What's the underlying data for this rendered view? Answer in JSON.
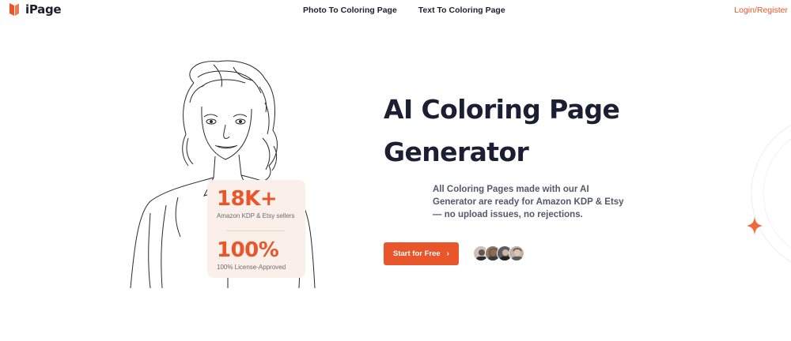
{
  "brand": {
    "name": "iPage",
    "color": "#e8562a"
  },
  "nav": {
    "links": [
      "Photo To Coloring Page",
      "Text To Coloring Page"
    ],
    "login": "Login/Register"
  },
  "hero": {
    "title_line1": "AI Coloring Page",
    "title_line2": "Generator",
    "description": "All Coloring Pages made with our AI Generator are ready for Amazon KDP & Etsy — no upload issues, no rejections.",
    "cta_label": "Start for Free",
    "cta_icon": "chevron-right-icon"
  },
  "stats": [
    {
      "value": "18K+",
      "label": "Amazon KDP & Etsy sellers"
    },
    {
      "value": "100%",
      "label": "100% License-Approved"
    }
  ],
  "avatars_count": 4
}
